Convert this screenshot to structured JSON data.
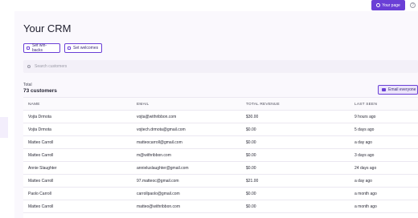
{
  "topbar": {
    "your_page_label": "Your page",
    "help_glyph": "?"
  },
  "page": {
    "title": "Your CRM"
  },
  "actions": {
    "winbacks_label": "Set win-backs",
    "welcomes_label": "Set welcomes"
  },
  "search": {
    "placeholder": "Search customers",
    "value": ""
  },
  "summary": {
    "total_label": "Total",
    "count_label": "73 customers"
  },
  "email_everyone_label": "Email everyone",
  "table": {
    "headers": [
      "NAME",
      "EMAIL",
      "TOTAL REVENUE",
      "LAST SEEN"
    ],
    "rows": [
      [
        "Vojta Drmota",
        "vojta@withribbon.com",
        "$30.00",
        "9 hours ago"
      ],
      [
        "Vojta Drmota",
        "vojtech.drmota@gmail.com",
        "$0.00",
        "5 days ago"
      ],
      [
        "Matteo Carroll",
        "matteocarroll@gmail.com",
        "$0.00",
        "a day ago"
      ],
      [
        "Matteo Carroll",
        "m@withribbon.com",
        "$0.00",
        "3 days ago"
      ],
      [
        "Annie Slaughter",
        "annieluslaughter@gmail.com",
        "$0.00",
        "24 days ago"
      ],
      [
        "Matteo Carroll",
        "97.matteoc@gmail.com",
        "$21.00",
        "a day ago"
      ],
      [
        "Paolo Carroll",
        "carrollpaolo@gmail.com",
        "$0.00",
        "a month ago"
      ],
      [
        "Matteo Carroll",
        "matteo@withribbon.com",
        "$0.00",
        "a month ago"
      ]
    ]
  },
  "colors": {
    "accent": "#6a3fd6",
    "background": "#faf8fd"
  }
}
